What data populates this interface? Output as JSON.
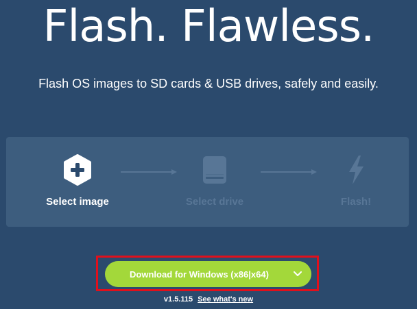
{
  "hero": {
    "title": "Flash. Flawless.",
    "tagline": "Flash OS images to SD cards & USB drives, safely and easily."
  },
  "steps": [
    {
      "label": "Select image",
      "icon": "plus-hexagon-icon",
      "state": "active"
    },
    {
      "label": "Select drive",
      "icon": "drive-icon",
      "state": "disabled"
    },
    {
      "label": "Flash!",
      "icon": "lightning-icon",
      "state": "disabled"
    }
  ],
  "download": {
    "label": "Download for Windows (x86|x64)",
    "caret_icon": "chevron-down-icon",
    "version": "v1.5.115",
    "whats_new": "See what's new"
  },
  "colors": {
    "background": "#2b4a6d",
    "panel": "#3d5d7e",
    "accent_green": "#a3d83a",
    "highlight_red": "#e0101c",
    "dim_text": "#587696"
  }
}
